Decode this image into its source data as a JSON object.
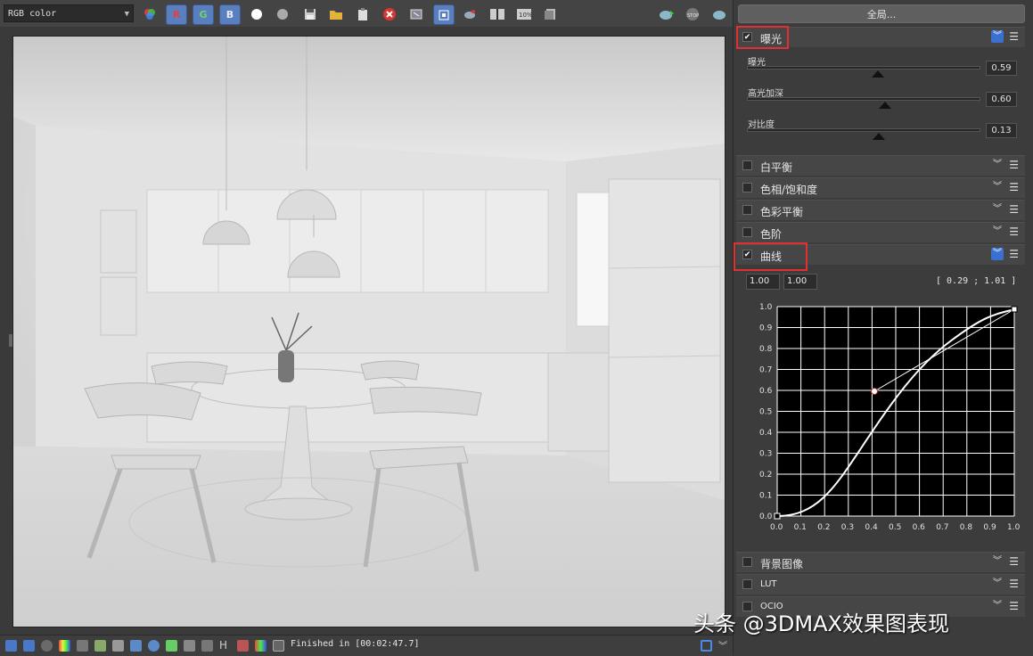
{
  "toolbar": {
    "channel": "RGB color",
    "r": "R",
    "g": "G",
    "b": "B"
  },
  "right_panel": {
    "global_button": "全局...",
    "sections": {
      "exposure": "曝光",
      "white_balance": "白平衡",
      "hue_sat": "色相/饱和度",
      "color_balance": "色彩平衡",
      "levels": "色阶",
      "curves": "曲线",
      "background": "背景图像",
      "lut": "LUT",
      "ocio": "OCIO"
    },
    "exposure_sliders": [
      {
        "label": "曝光",
        "value": "0.59",
        "pos": 0.59
      },
      {
        "label": "高光加深",
        "value": "0.60",
        "pos": 0.6
      },
      {
        "label": "对比度",
        "value": "0.13",
        "pos": 0.57
      }
    ],
    "curves": {
      "input_a": "1.00",
      "input_b": "1.00",
      "coord": "[ 0.29 ; 1.01 ]",
      "y_ticks": [
        "1.0",
        "0.9",
        "0.8",
        "0.7",
        "0.6",
        "0.5",
        "0.4",
        "0.3",
        "0.2",
        "0.1",
        "0.0"
      ],
      "x_ticks": [
        "0.0",
        "0.1",
        "0.2",
        "0.3",
        "0.4",
        "0.5",
        "0.6",
        "0.7",
        "0.8",
        "0.9",
        "1.0"
      ]
    }
  },
  "status": {
    "text": "Finished in [00:02:47.7]"
  },
  "watermark": "头条 @3DMAX效果图表现"
}
